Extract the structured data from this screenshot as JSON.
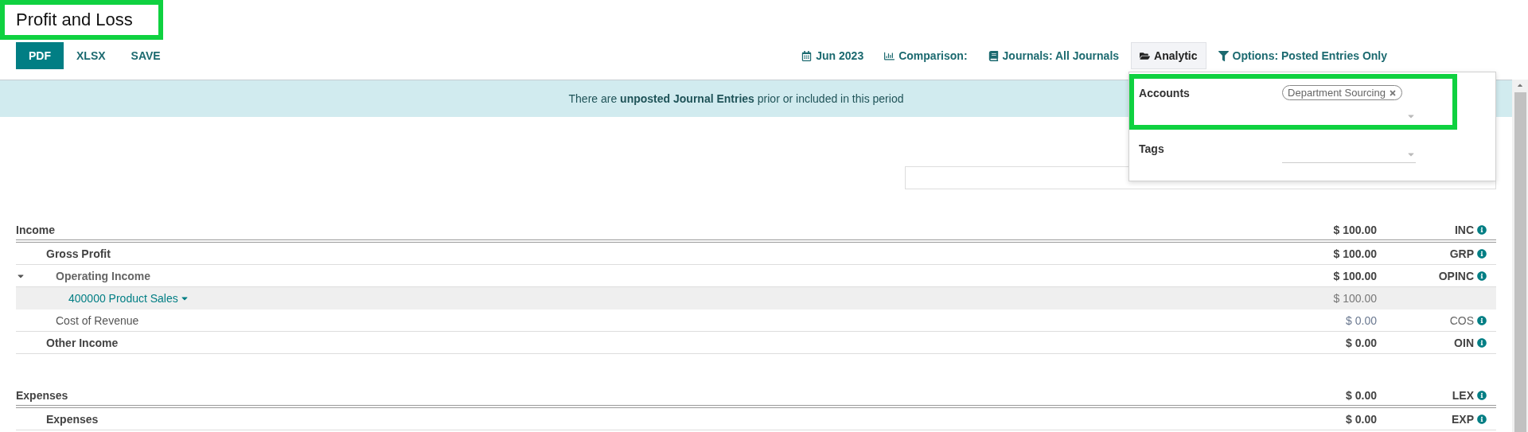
{
  "title": {
    "text": "Profit and Loss",
    "highlighted": true
  },
  "actions": [
    {
      "label": "PDF",
      "primary": true
    },
    {
      "label": "XLSX",
      "primary": false
    },
    {
      "label": "SAVE",
      "primary": false
    }
  ],
  "filters": [
    {
      "label": "Jun 2023",
      "selected": false
    },
    {
      "label": "Comparison:",
      "selected": false
    },
    {
      "label": "Journals: All Journals",
      "selected": false
    },
    {
      "label": "Analytic",
      "selected": true
    },
    {
      "label": "Options: Posted Entries Only",
      "selected": false
    }
  ],
  "analytic_dropdown": {
    "rows": [
      {
        "label": "Accounts",
        "tags": [
          "Department Sourcing"
        ],
        "highlighted": true
      },
      {
        "label": "Tags",
        "highlighted": false
      }
    ]
  },
  "banner": "There are **unposted Journal Entries** prior or included in this period",
  "report": {
    "rows": [
      {
        "name": "Income",
        "amount": "$ 100.00",
        "code": "INC",
        "kind": "group",
        "children": [
          {
            "name": "Gross Profit",
            "amount": "$ 100.00",
            "code": "GRP",
            "kind": "group",
            "children": [
              {
                "name": "Operating Income",
                "amount": "$ 100.00",
                "code": "OPINC",
                "kind": "group",
                "expanded": true,
                "children": [
                  {
                    "name": "400000 Product Sales",
                    "amount": "$ 100.00",
                    "kind": "account"
                  }
                ]
              },
              {
                "name": "Cost of Revenue",
                "amount": "$ 0.00",
                "code": "COS",
                "kind": "line"
              }
            ]
          },
          {
            "name": "Other Income",
            "amount": "$ 0.00",
            "code": "OIN",
            "kind": "group"
          }
        ]
      },
      {
        "name": "Expenses",
        "amount": "$ 0.00",
        "code": "LEX",
        "kind": "group",
        "children": [
          {
            "name": "Expenses",
            "amount": "$ 0.00",
            "code": "EXP",
            "kind": "group"
          }
        ]
      }
    ]
  }
}
